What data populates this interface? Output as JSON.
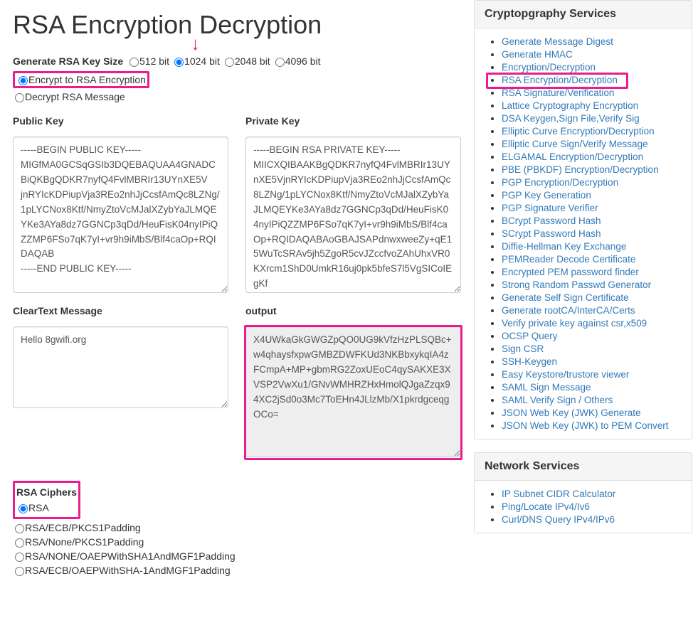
{
  "page": {
    "title": "RSA Encryption Decryption"
  },
  "keysize": {
    "label": "Generate RSA Key Size",
    "options": [
      {
        "label": "512 bit",
        "value": "512",
        "checked": false
      },
      {
        "label": "1024 bit",
        "value": "1024",
        "checked": true
      },
      {
        "label": "2048 bit",
        "value": "2048",
        "checked": false
      },
      {
        "label": "4096 bit",
        "value": "4096",
        "checked": false
      }
    ]
  },
  "mode": {
    "options": [
      {
        "label": "Encrypt to RSA Encryption",
        "checked": true
      },
      {
        "label": "Decrypt RSA Message",
        "checked": false
      }
    ]
  },
  "fields": {
    "public_key_label": "Public Key",
    "private_key_label": "Private Key",
    "cleartext_label": "ClearText Message",
    "output_label": "output",
    "public_key": "-----BEGIN PUBLIC KEY-----\nMIGfMA0GCSqGSIb3DQEBAQUAA4GNADCBiQKBgQDKR7nyfQ4FvlMBRIr13UYnXE5V\njnRYIcKDPiupVja3REo2nhJjCcsfAmQc8LZNg/1pLYCNox8Ktf/NmyZtoVcMJalXZybYaJLMQEYKe3AYa8dz7GGNCp3qDd/HeuFisK04nyIPiQZZMP6FSo7qK7yI+vr9h9iMbS/Blf4caOp+RQIDAQAB\n-----END PUBLIC KEY-----",
    "private_key": "-----BEGIN RSA PRIVATE KEY-----\nMIICXQIBAAKBgQDKR7nyfQ4FvlMBRIr13UYnXE5VjnRYIcKDPiupVja3REo2nhJjCcsfAmQc8LZNg/1pLYCNox8Ktf/NmyZtoVcMJalXZybYaJLMQEYKe3AYa8dz7GGNCp3qDd/HeuFisK04nyIPiQZZMP6FSo7qK7yI+vr9h9iMbS/Blf4caOp+RQIDAQABAoGBAJSAPdnwxweeZy+qE15WuTcSRAv5jh5ZgoR5cvJZccfvoZAhUhxVR0KXrcm1ShD0UmkR16uj0pk5bfeS7l5VgSICoIEgKf",
    "cleartext": "Hello 8gwifi.org",
    "output": "X4UWkaGkGWGZpQO0UG9kVfzHzPLSQBc+w4qhaysfxpwGMBZDWFKUd3NKBbxykqIA4zFCmpA+MP+gbmRG2ZoxUEoC4qySAKXE3XVSP2VwXu1/GNvWMHRZHxHmolQJgaZzqx94XC2jSd0o3Mc7ToEHn4JLlzMb/X1pkrdgceqgOCo="
  },
  "ciphers": {
    "title": "RSA Ciphers",
    "options": [
      {
        "label": "RSA",
        "checked": true
      },
      {
        "label": "RSA/ECB/PKCS1Padding",
        "checked": false
      },
      {
        "label": "RSA/None/PKCS1Padding",
        "checked": false
      },
      {
        "label": "RSA/NONE/OAEPWithSHA1AndMGF1Padding",
        "checked": false
      },
      {
        "label": "RSA/ECB/OAEPWithSHA-1AndMGF1Padding",
        "checked": false
      }
    ]
  },
  "sidebar": {
    "panels": [
      {
        "title": "Cryptopgraphy Services",
        "items": [
          "Generate Message Digest",
          "Generate HMAC",
          "Encryption/Decryption",
          "RSA Encryption/Decryption",
          "RSA Signature/Verification",
          "Lattice Cryptography Encryption",
          "DSA Keygen,Sign File,Verify Sig",
          "Elliptic Curve Encryption/Decryption",
          "Elliptic Curve Sign/Verify Message",
          "ELGAMAL Encryption/Decryption",
          "PBE (PBKDF) Encryption/Decryption",
          "PGP Encryption/Decryption",
          "PGP Key Generation",
          "PGP Signature Verifier",
          "BCrypt Password Hash",
          "SCrypt Password Hash",
          "Diffie-Hellman Key Exchange",
          "PEMReader Decode Certificate",
          "Encrypted PEM password finder",
          "Strong Random Passwd Generator",
          "Generate Self Sign Certificate",
          "Generate rootCA/InterCA/Certs",
          "Verify private key against csr,x509",
          "OCSP Query",
          "Sign CSR",
          "SSH-Keygen",
          "Easy Keystore/trustore viewer",
          "SAML Sign Message",
          "SAML Verify Sign / Others",
          "JSON Web Key (JWK) Generate",
          "JSON Web Key (JWK) to PEM Convert"
        ]
      },
      {
        "title": "Network Services",
        "items": [
          "IP Subnet CIDR Calculator",
          "Ping/Locate IPv4/Iv6",
          "Curl/DNS Query IPv4/IPv6"
        ]
      }
    ]
  }
}
